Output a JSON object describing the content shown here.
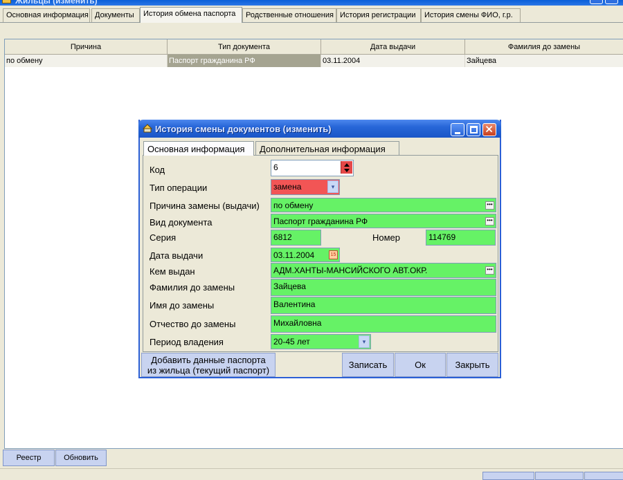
{
  "window": {
    "title": "Жильцы (изменить)"
  },
  "tabs": [
    {
      "label": "Основная информация"
    },
    {
      "label": "Документы"
    },
    {
      "label": "История обмена паспорта"
    },
    {
      "label": "Родственные отношения"
    },
    {
      "label": "История регистрации"
    },
    {
      "label": "История смены ФИО, г.р."
    }
  ],
  "table": {
    "columns": [
      "Причина",
      "Тип документа",
      "Дата выдачи",
      "Фамилия до замены"
    ],
    "rows": [
      [
        "по обмену",
        "Паспорт гражданина РФ",
        "03.11.2004",
        "Зайцева"
      ]
    ]
  },
  "bottom": {
    "registry_label": "Реестр",
    "refresh_label": "Обновить"
  },
  "dialog": {
    "title": "История смены документов (изменить)",
    "tabs": [
      {
        "label": "Основная информация"
      },
      {
        "label": "Дополнительная информация"
      }
    ],
    "fields": {
      "code": {
        "label": "Код",
        "value": "6"
      },
      "operation_type": {
        "label": "Тип операции",
        "value": "замена"
      },
      "reason": {
        "label": "Причина замены (выдачи)",
        "value": "по обмену"
      },
      "doc_type": {
        "label": "Вид документа",
        "value": "Паспорт гражданина РФ"
      },
      "series": {
        "label": "Серия",
        "value": "6812"
      },
      "number": {
        "label": "Номер",
        "value": "114769"
      },
      "issue_date": {
        "label": "Дата выдачи",
        "value": "03.11.2004"
      },
      "issued_by": {
        "label": "Кем выдан",
        "value": "АДМ.ХАНТЫ-МАНСИЙСКОГО АВТ.ОКР."
      },
      "last_name": {
        "label": "Фамилия до замены",
        "value": "Зайцева"
      },
      "first_name": {
        "label": "Имя до замены",
        "value": "Валентина"
      },
      "patronymic": {
        "label": "Отчество до замены",
        "value": "Михайловна"
      },
      "ownership_period": {
        "label": "Период владения",
        "value": "20-45 лет"
      }
    },
    "buttons": {
      "add_passport_line1": "Добавить данные паспорта",
      "add_passport_line2": "из жильца (текущий паспорт)",
      "save": "Записать",
      "ok": "Ок",
      "close": "Закрыть"
    }
  },
  "colors": {
    "field_green": "#66f266",
    "field_red": "#f25555",
    "title_blue": "#2766d8",
    "selected_cell": "#a5a491"
  }
}
